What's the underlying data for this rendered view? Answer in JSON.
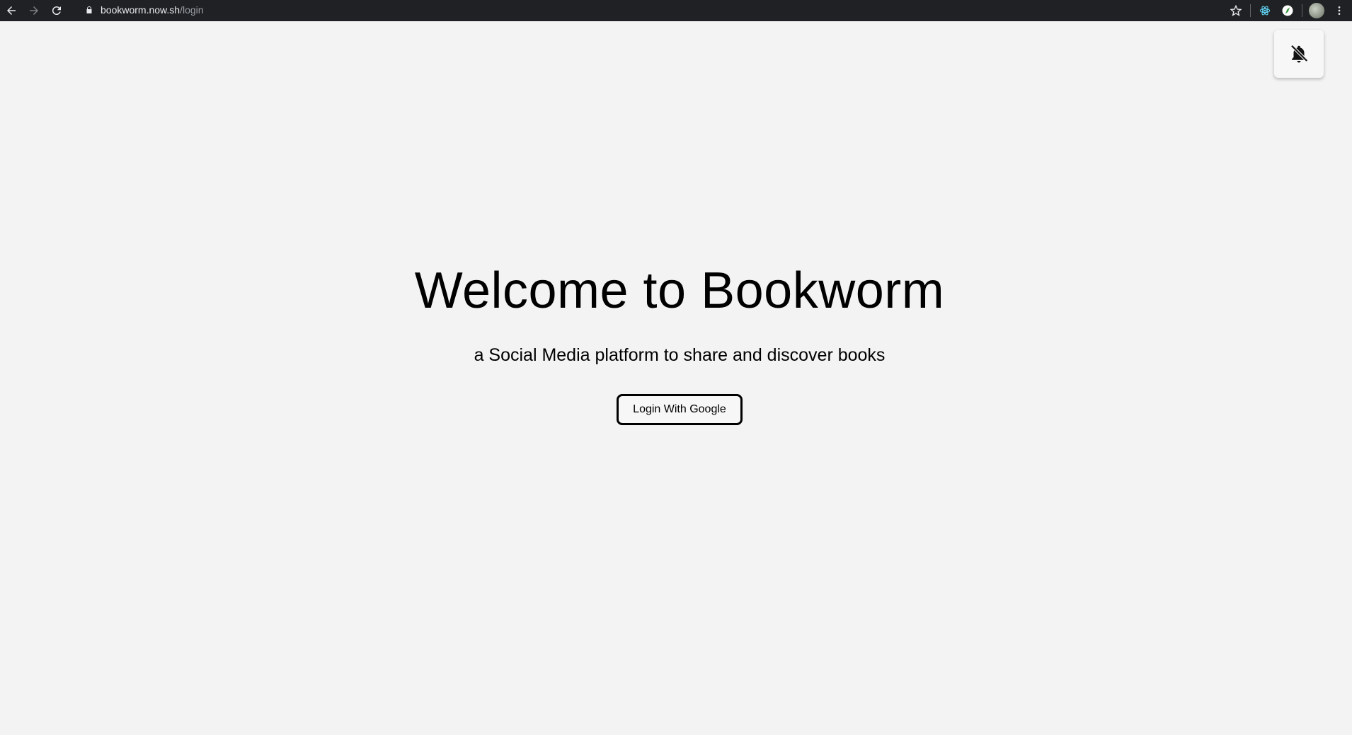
{
  "browser": {
    "url_host": "bookworm.now.sh",
    "url_path": "/login",
    "back_icon": "arrow-left-icon",
    "forward_icon": "arrow-right-icon",
    "reload_icon": "reload-icon",
    "lock_icon": "lock-icon",
    "bookmark_icon": "star-icon",
    "extensions": [
      "react-devtools-icon",
      "compass-extension-icon"
    ],
    "menu_icon": "kebab-menu-icon"
  },
  "page": {
    "toggle_icon": "bell-off-icon",
    "title": "Welcome to Bookworm",
    "subtitle": "a Social Media platform to share and discover books",
    "login_button": "Login With Google"
  }
}
